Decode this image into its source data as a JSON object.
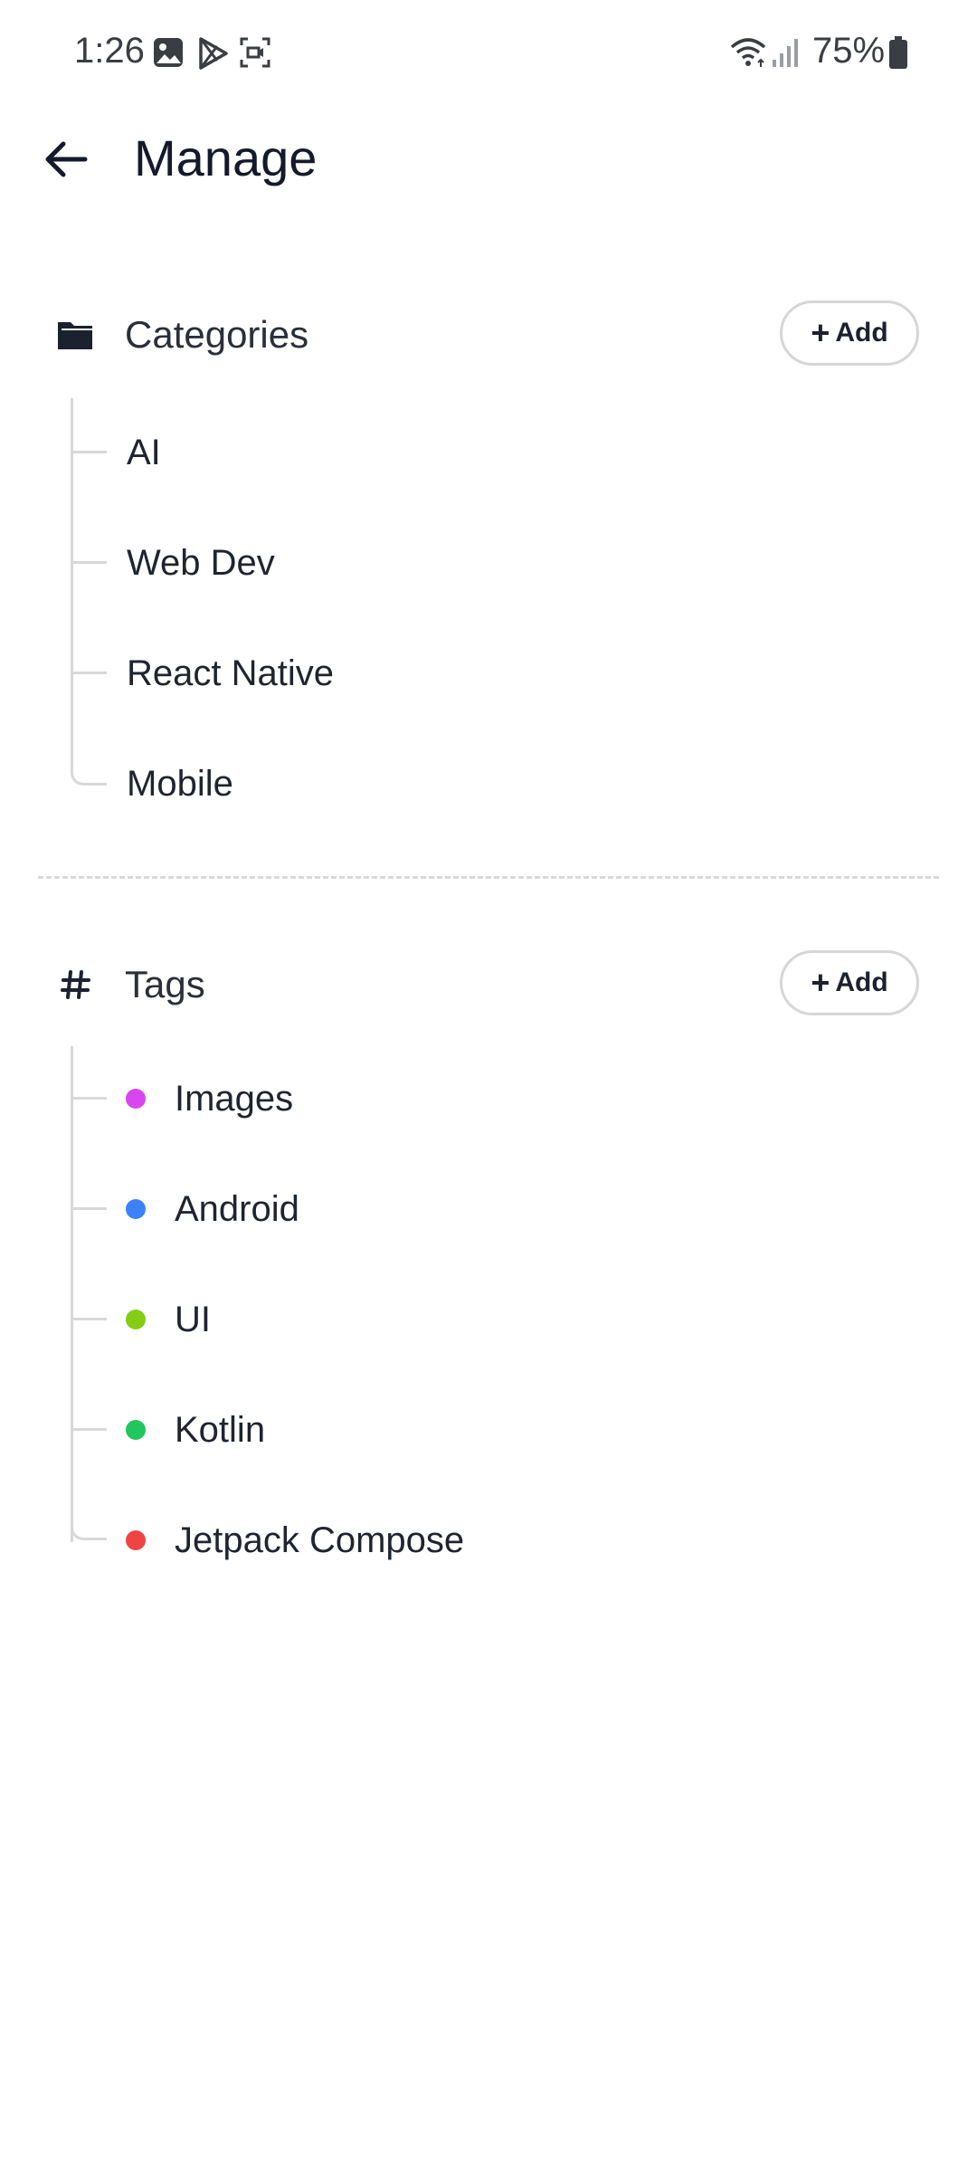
{
  "status_bar": {
    "time": "1:26",
    "battery": "75%",
    "icons": [
      "gallery-icon",
      "play-store-icon",
      "screen-record-icon",
      "wifi-icon",
      "signal-icon",
      "battery-icon"
    ]
  },
  "header": {
    "title": "Manage",
    "back_icon": "arrow-left-icon"
  },
  "categories": {
    "title": "Categories",
    "icon": "folder-icon",
    "add_label": "Add",
    "items": [
      {
        "label": "AI"
      },
      {
        "label": "Web Dev"
      },
      {
        "label": "React Native"
      },
      {
        "label": "Mobile"
      }
    ]
  },
  "tags": {
    "title": "Tags",
    "icon": "hash-icon",
    "add_label": "Add",
    "items": [
      {
        "label": "Images",
        "color": "#d946ef"
      },
      {
        "label": "Android",
        "color": "#3b82f6"
      },
      {
        "label": "UI",
        "color": "#84cc16"
      },
      {
        "label": "Kotlin",
        "color": "#22c55e"
      },
      {
        "label": "Jetpack Compose",
        "color": "#ef4444"
      }
    ]
  }
}
